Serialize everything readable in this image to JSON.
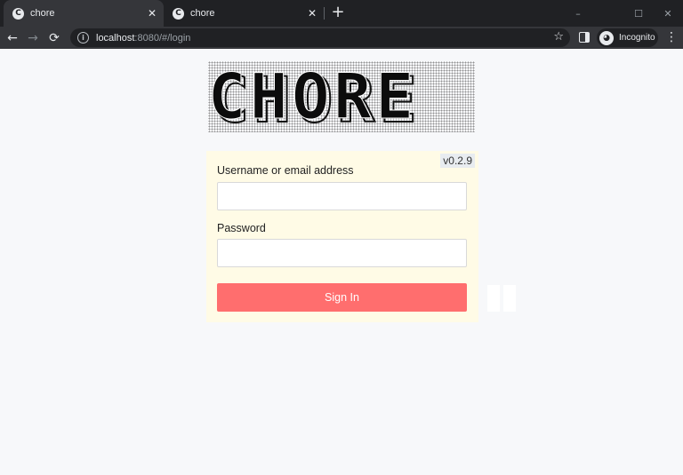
{
  "browser": {
    "tabs": [
      {
        "title": "chore",
        "favicon": "C"
      },
      {
        "title": "chore",
        "favicon": "C"
      }
    ],
    "tab_close_glyph": "✕",
    "new_tab_glyph": "+",
    "window_controls": {
      "minimize": "–",
      "maximize": "☐",
      "close": "✕"
    },
    "nav": {
      "back": "←",
      "forward": "→",
      "reload": "⟳"
    },
    "address": {
      "host": "localhost",
      "rest": ":8080/#/login",
      "info_glyph": "i"
    },
    "star_glyph": "☆",
    "profile_label": "Incognito",
    "profile_glyph": "◕",
    "menu_glyph": "⋮"
  },
  "page": {
    "logo_text": "CHORE",
    "version": "v0.2.9",
    "form": {
      "username_label": "Username or email address",
      "username_value": "",
      "password_label": "Password",
      "password_value": "",
      "submit_label": "Sign In"
    }
  },
  "colors": {
    "submit_button": "#ff6e6e",
    "card_background": "#fffbe6",
    "page_background": "#f7f8fa",
    "chrome_dark": "#202124"
  }
}
